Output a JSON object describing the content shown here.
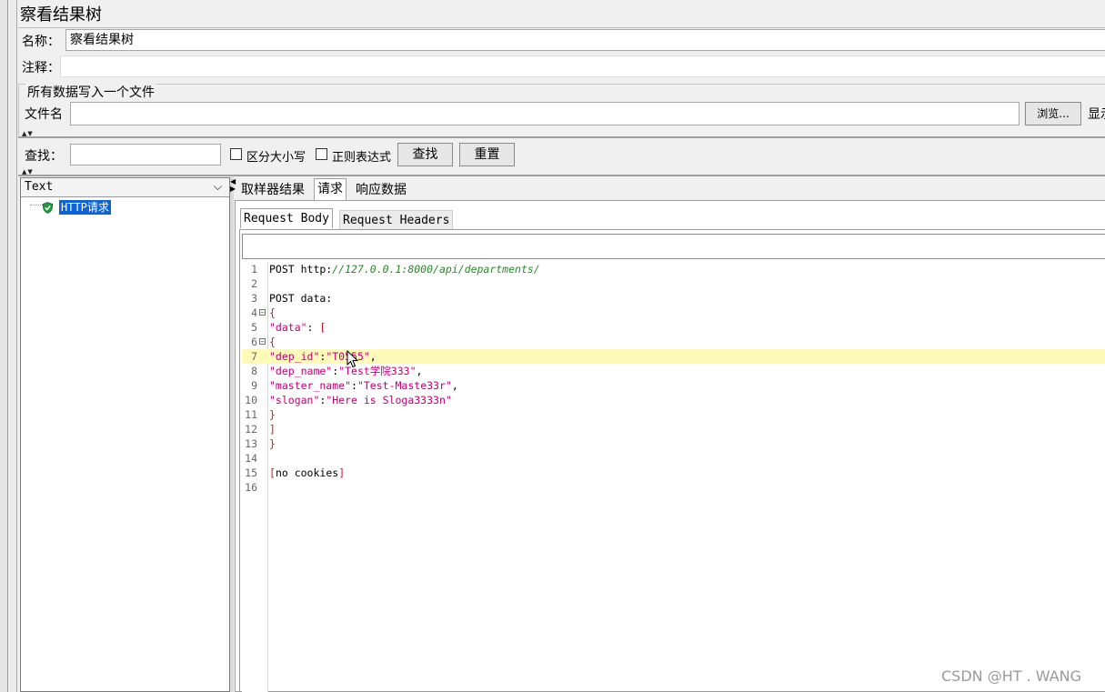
{
  "window": {
    "title": "察看结果树"
  },
  "form": {
    "name_label": "名称：",
    "name_value": "察看结果树",
    "comment_label": "注释：",
    "comment_value": ""
  },
  "file_section": {
    "legend": "所有数据写入一个文件",
    "filename_label": "文件名",
    "filename_value": "",
    "browse_button": "浏览...",
    "display_label": "显示"
  },
  "search": {
    "label": "查找：",
    "value": "",
    "case_sensitive": "区分大小写",
    "regex": "正则表达式",
    "find_button": "查找",
    "reset_button": "重置"
  },
  "tree": {
    "renderer_select": "Text",
    "items": [
      {
        "label": "HTTP请求",
        "status": "success"
      }
    ]
  },
  "tabs": [
    "取样器结果",
    "请求",
    "响应数据"
  ],
  "active_tab": "请求",
  "subtabs": [
    "Request Body",
    "Request Headers"
  ],
  "active_subtab": "Request Body",
  "code": {
    "lines": [
      {
        "n": "1",
        "parts": [
          {
            "t": "POST http:",
            "c": ""
          },
          {
            "t": "//127.0.0.1:8000/api/departments/",
            "c": "s"
          }
        ]
      },
      {
        "n": "2",
        "parts": []
      },
      {
        "n": "3",
        "parts": [
          {
            "t": "POST data:",
            "c": ""
          }
        ]
      },
      {
        "n": "4",
        "fold": true,
        "parts": [
          {
            "t": "{",
            "c": "p"
          }
        ]
      },
      {
        "n": "5",
        "parts": [
          {
            "t": "\"data\"",
            "c": "k"
          },
          {
            "t": ": ",
            "c": ""
          },
          {
            "t": "[",
            "c": "p"
          }
        ]
      },
      {
        "n": "6",
        "fold": true,
        "parts": [
          {
            "t": "{",
            "c": "p"
          }
        ]
      },
      {
        "n": "7",
        "hl": true,
        "parts": [
          {
            "t": "\"dep_id\"",
            "c": "k"
          },
          {
            "t": ":",
            "c": ""
          },
          {
            "t": "\"T0555\"",
            "c": "k"
          },
          {
            "t": ",",
            "c": ""
          }
        ]
      },
      {
        "n": "8",
        "parts": [
          {
            "t": "\"dep_name\"",
            "c": "k"
          },
          {
            "t": ":",
            "c": ""
          },
          {
            "t": "\"Test学院333\"",
            "c": "k"
          },
          {
            "t": ",",
            "c": ""
          }
        ]
      },
      {
        "n": "9",
        "parts": [
          {
            "t": "\"master_name\"",
            "c": "k"
          },
          {
            "t": ":",
            "c": ""
          },
          {
            "t": "\"Test-Maste33r\"",
            "c": "k"
          },
          {
            "t": ",",
            "c": ""
          }
        ]
      },
      {
        "n": "10",
        "parts": [
          {
            "t": "\"slogan\"",
            "c": "k"
          },
          {
            "t": ":",
            "c": ""
          },
          {
            "t": "\"Here is Sloga3333n\"",
            "c": "k"
          }
        ]
      },
      {
        "n": "11",
        "parts": [
          {
            "t": "}",
            "c": "p"
          }
        ]
      },
      {
        "n": "12",
        "parts": [
          {
            "t": "]",
            "c": "p"
          }
        ]
      },
      {
        "n": "13",
        "parts": [
          {
            "t": "}",
            "c": "p"
          }
        ]
      },
      {
        "n": "14",
        "parts": []
      },
      {
        "n": "15",
        "parts": [
          {
            "t": "[",
            "c": "p"
          },
          {
            "t": "no cookies",
            "c": ""
          },
          {
            "t": "]",
            "c": "p"
          }
        ]
      },
      {
        "n": "16",
        "parts": []
      }
    ]
  },
  "watermark": "CSDN @HT . WANG",
  "colors": {
    "selection": "#0a64d8",
    "highlight_line": "#fffab8",
    "key_magenta": "#c0007a",
    "url_green": "#2a8a2a",
    "bracket_red": "#c8192a",
    "status_ok": "#1e9a3a"
  }
}
